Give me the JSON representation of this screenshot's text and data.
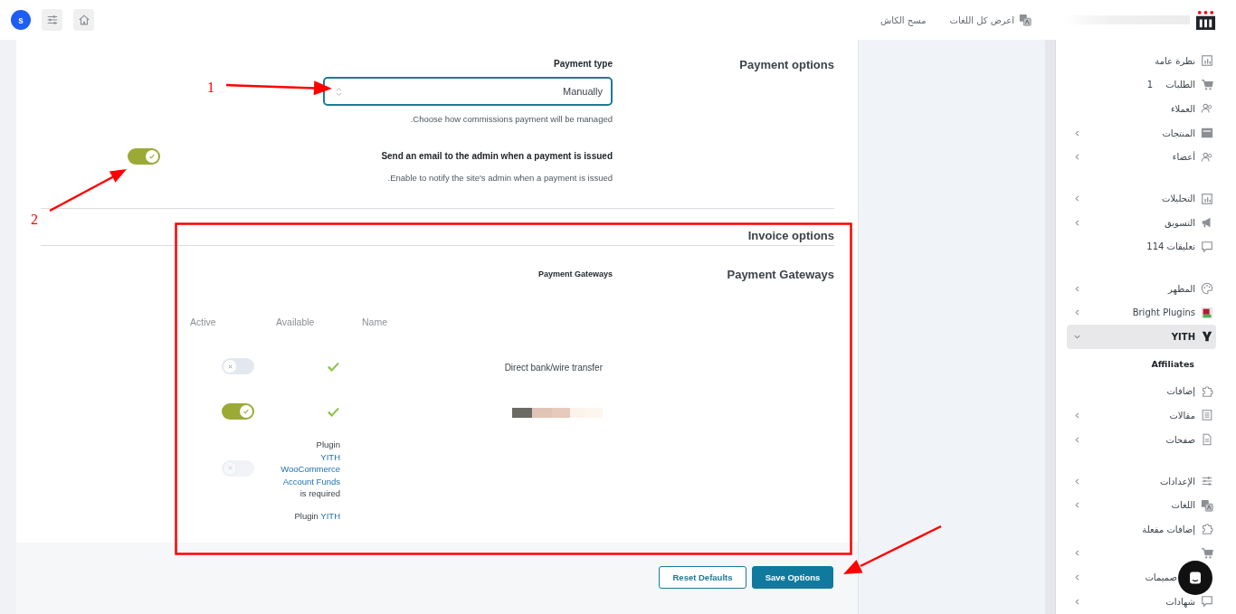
{
  "topbar": {
    "avatar": "s",
    "actions": [
      {
        "label": "اعرض كل اللغات"
      },
      {
        "label": "مسح الكاش"
      }
    ]
  },
  "sidebar": {
    "groups": [
      [
        {
          "label": "نظرة عامة",
          "selected": false
        },
        {
          "label": "الطلبات",
          "badge": "1",
          "selected": false
        },
        {
          "label": "العملاء",
          "selected": false
        },
        {
          "label": "المنتجات",
          "expanded": false,
          "selected": false
        },
        {
          "label": "أعضاء",
          "expanded": false,
          "selected": false
        }
      ],
      [
        {
          "label": "التحليلات",
          "expanded": false,
          "selected": false
        },
        {
          "label": "التسويق",
          "expanded": false,
          "selected": false
        },
        {
          "label": "تعليقات 114",
          "selected": false
        }
      ],
      [
        {
          "label": "المظهر",
          "expanded": false,
          "selected": false
        },
        {
          "label": "Bright Plugins",
          "expanded": false,
          "selected": false
        },
        {
          "label": "YITH",
          "expanded": true,
          "selected": true,
          "children": [
            {
              "label": "Affiliates",
              "selected": true
            }
          ]
        },
        {
          "label": "إضافات",
          "selected": false
        },
        {
          "label": "مقالات",
          "expanded": false,
          "selected": false
        },
        {
          "label": "صفحات",
          "expanded": false,
          "selected": false
        }
      ],
      [
        {
          "label": "الإعدادات",
          "expanded": false,
          "selected": false
        },
        {
          "label": "اللغات",
          "expanded": false,
          "selected": false
        },
        {
          "label": "إضافات مفعلة",
          "selected": false
        },
        {
          "expanded": false,
          "selected": false
        },
        {
          "label": "صميمات",
          "expanded": false,
          "selected": false
        },
        {
          "label": "شهادات",
          "expanded": false,
          "selected": false
        }
      ]
    ]
  },
  "payment_options": {
    "title": "Payment options",
    "payment_type": {
      "label": "Payment type",
      "value": "Manually",
      "help": ".Choose how commissions payment will be managed"
    },
    "email_toggle": {
      "label": "Send an email to the admin when a payment is issued",
      "help": ".Enable to notify the site's admin when a payment is issued",
      "on": true
    }
  },
  "invoice_options": {
    "title": "Invoice options"
  },
  "payment_gateways": {
    "title": "Payment Gateways",
    "label": "Payment Gateways",
    "columns": [
      "Name",
      "Available",
      "Active"
    ],
    "rows": [
      {
        "active": false,
        "available": {
          "kind": "check"
        },
        "name": {
          "kind": "text",
          "text": "Direct bank/wire transfer"
        }
      },
      {
        "active": true,
        "available": {
          "kind": "check"
        }
      },
      {
        "active": false,
        "disabled": true,
        "available": {
          "kind": "note",
          "prefix": "Plugin",
          "link": "YITH WooCommerce Account Funds",
          "suffix": "is required"
        }
      },
      {
        "available": {
          "kind": "note",
          "prefix": "Plugin",
          "link": "YITH"
        }
      }
    ]
  },
  "buttons": [
    {
      "label": "Save Options",
      "kind": "primary"
    },
    {
      "label": "Reset Defaults",
      "kind": "secondary"
    }
  ],
  "annotations": {
    "labels": [
      "1",
      "2"
    ]
  }
}
